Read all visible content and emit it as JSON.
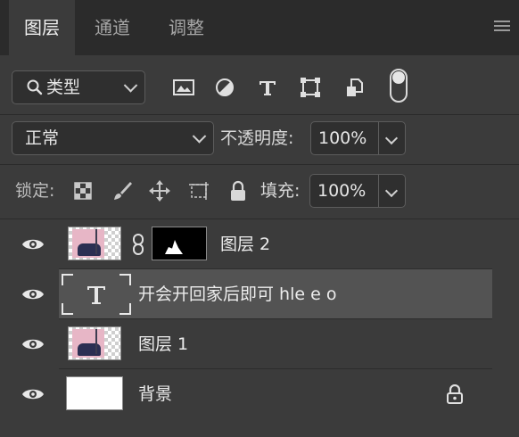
{
  "tabs": [
    {
      "label": "图层",
      "active": true
    },
    {
      "label": "通道",
      "active": false
    },
    {
      "label": "调整",
      "active": false
    }
  ],
  "filter": {
    "kind_label": "类型",
    "icons": [
      "image-filter-icon",
      "adjustment-filter-icon",
      "type-filter-icon",
      "shape-filter-icon",
      "smart-object-filter-icon"
    ]
  },
  "blend": {
    "mode": "正常",
    "opacity_label": "不透明度:",
    "opacity_value": "100%"
  },
  "lock": {
    "label": "锁定:",
    "fill_label": "填充:",
    "fill_value": "100%"
  },
  "layers": [
    {
      "name": "图层 2",
      "visible": true,
      "selected": false
    },
    {
      "name": "开会开回家后即可 hle e o",
      "visible": true,
      "selected": true
    },
    {
      "name": "图层 1",
      "visible": true,
      "selected": false
    },
    {
      "name": "背景",
      "visible": true,
      "selected": false,
      "locked": true
    }
  ],
  "colors": {
    "panel": "#3b3b3b",
    "selected_row": "#535353",
    "tab_bar": "#2b2b2b"
  }
}
